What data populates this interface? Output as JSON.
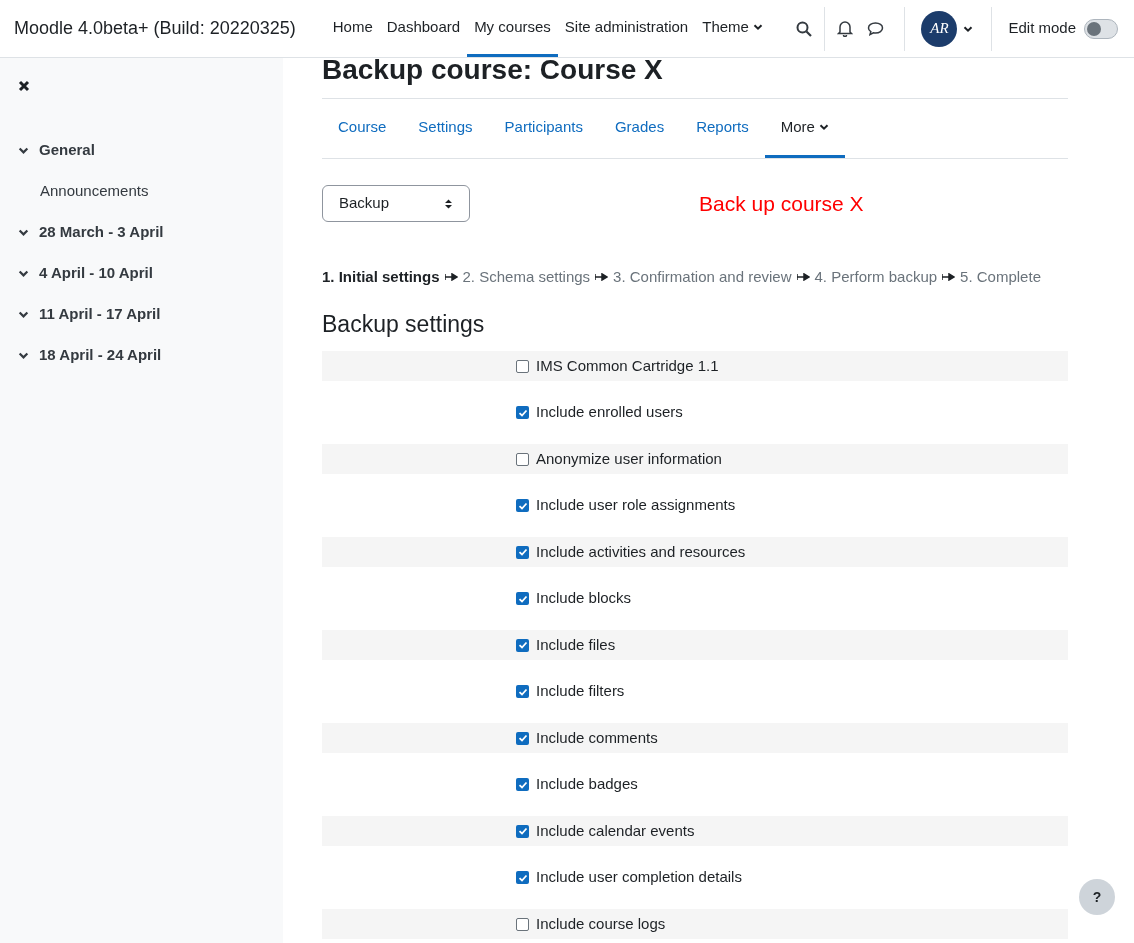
{
  "navbar": {
    "site_name": "Moodle 4.0beta+ (Build: 20220325)",
    "links": [
      {
        "label": "Home",
        "selected": false,
        "dropdown": false
      },
      {
        "label": "Dashboard",
        "selected": false,
        "dropdown": false
      },
      {
        "label": "My courses",
        "selected": true,
        "dropdown": false
      },
      {
        "label": "Site administration",
        "selected": false,
        "dropdown": false
      },
      {
        "label": "Theme",
        "selected": false,
        "dropdown": true
      }
    ],
    "avatar": "AR",
    "edit_mode": {
      "label": "Edit mode",
      "on": false
    }
  },
  "sidebar": {
    "items": [
      {
        "label": "General",
        "expanded": true,
        "children": [
          {
            "label": "Announcements"
          }
        ]
      },
      {
        "label": "28 March - 3 April",
        "expanded": true
      },
      {
        "label": "4 April - 10 April",
        "expanded": true
      },
      {
        "label": "11 April - 17 April",
        "expanded": true
      },
      {
        "label": "18 April - 24 April",
        "expanded": true
      }
    ]
  },
  "page_title": "Backup course: Course X",
  "tabs": [
    {
      "label": "Course",
      "selected": false,
      "dropdown": false
    },
    {
      "label": "Settings",
      "selected": false,
      "dropdown": false
    },
    {
      "label": "Participants",
      "selected": false,
      "dropdown": false
    },
    {
      "label": "Grades",
      "selected": false,
      "dropdown": false
    },
    {
      "label": "Reports",
      "selected": false,
      "dropdown": false
    },
    {
      "label": "More",
      "selected": true,
      "dropdown": true
    }
  ],
  "action_select": {
    "value": "Backup"
  },
  "annotation": "Back up course X",
  "steps": [
    {
      "label": "1. Initial settings",
      "selected": true
    },
    {
      "label": "2. Schema settings",
      "selected": false
    },
    {
      "label": "3. Confirmation and review",
      "selected": false
    },
    {
      "label": "4. Perform backup",
      "selected": false
    },
    {
      "label": "5. Complete",
      "selected": false
    }
  ],
  "section_title": "Backup settings",
  "settings": [
    {
      "label": "IMS Common Cartridge 1.1",
      "checked": false
    },
    {
      "label": "Include enrolled users",
      "checked": true
    },
    {
      "label": "Anonymize user information",
      "checked": false
    },
    {
      "label": "Include user role assignments",
      "checked": true
    },
    {
      "label": "Include activities and resources",
      "checked": true
    },
    {
      "label": "Include blocks",
      "checked": true
    },
    {
      "label": "Include files",
      "checked": true
    },
    {
      "label": "Include filters",
      "checked": true
    },
    {
      "label": "Include comments",
      "checked": true
    },
    {
      "label": "Include badges",
      "checked": true
    },
    {
      "label": "Include calendar events",
      "checked": true
    },
    {
      "label": "Include user completion details",
      "checked": true
    },
    {
      "label": "Include course logs",
      "checked": false
    }
  ],
  "help_button": "?"
}
